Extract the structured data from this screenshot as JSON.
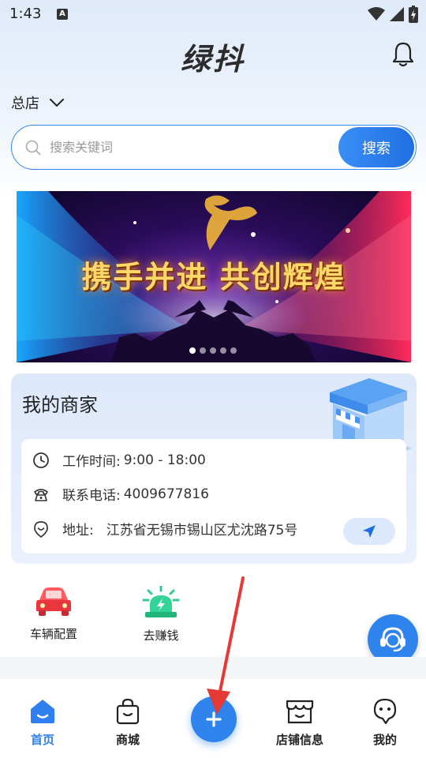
{
  "status_bar": {
    "time": "1:43",
    "notification_letter": "A"
  },
  "header": {
    "app_title": "绿抖"
  },
  "store": {
    "selected": "总店"
  },
  "search": {
    "placeholder": "搜索关键词",
    "button_label": "搜索"
  },
  "banner": {
    "title": "携手并进  共创辉煌",
    "slide_count": 5,
    "active_slide": 1
  },
  "merchant": {
    "title": "我的商家",
    "hours_label": "工作时间:",
    "hours_value": "9:00 - 18:00",
    "phone_label": "联系电话:",
    "phone_value": "4009677816",
    "address_label": "地址:",
    "address_value": "江苏省无锡市锡山区尤沈路75号"
  },
  "quick_actions": [
    {
      "label": "车辆配置",
      "icon": "car-icon"
    },
    {
      "label": "去赚钱",
      "icon": "siren-icon"
    }
  ],
  "bottom_nav": [
    {
      "label": "首页",
      "icon": "home-icon",
      "active": true
    },
    {
      "label": "商城",
      "icon": "shopping-bag-icon",
      "active": false
    },
    {
      "label": "店铺信息",
      "icon": "store-icon",
      "active": false
    },
    {
      "label": "我的",
      "icon": "profile-icon",
      "active": false
    }
  ],
  "colors": {
    "accent": "#2f83ec",
    "active_tab": "#2f7ff0",
    "annotation_arrow": "#e53935"
  }
}
